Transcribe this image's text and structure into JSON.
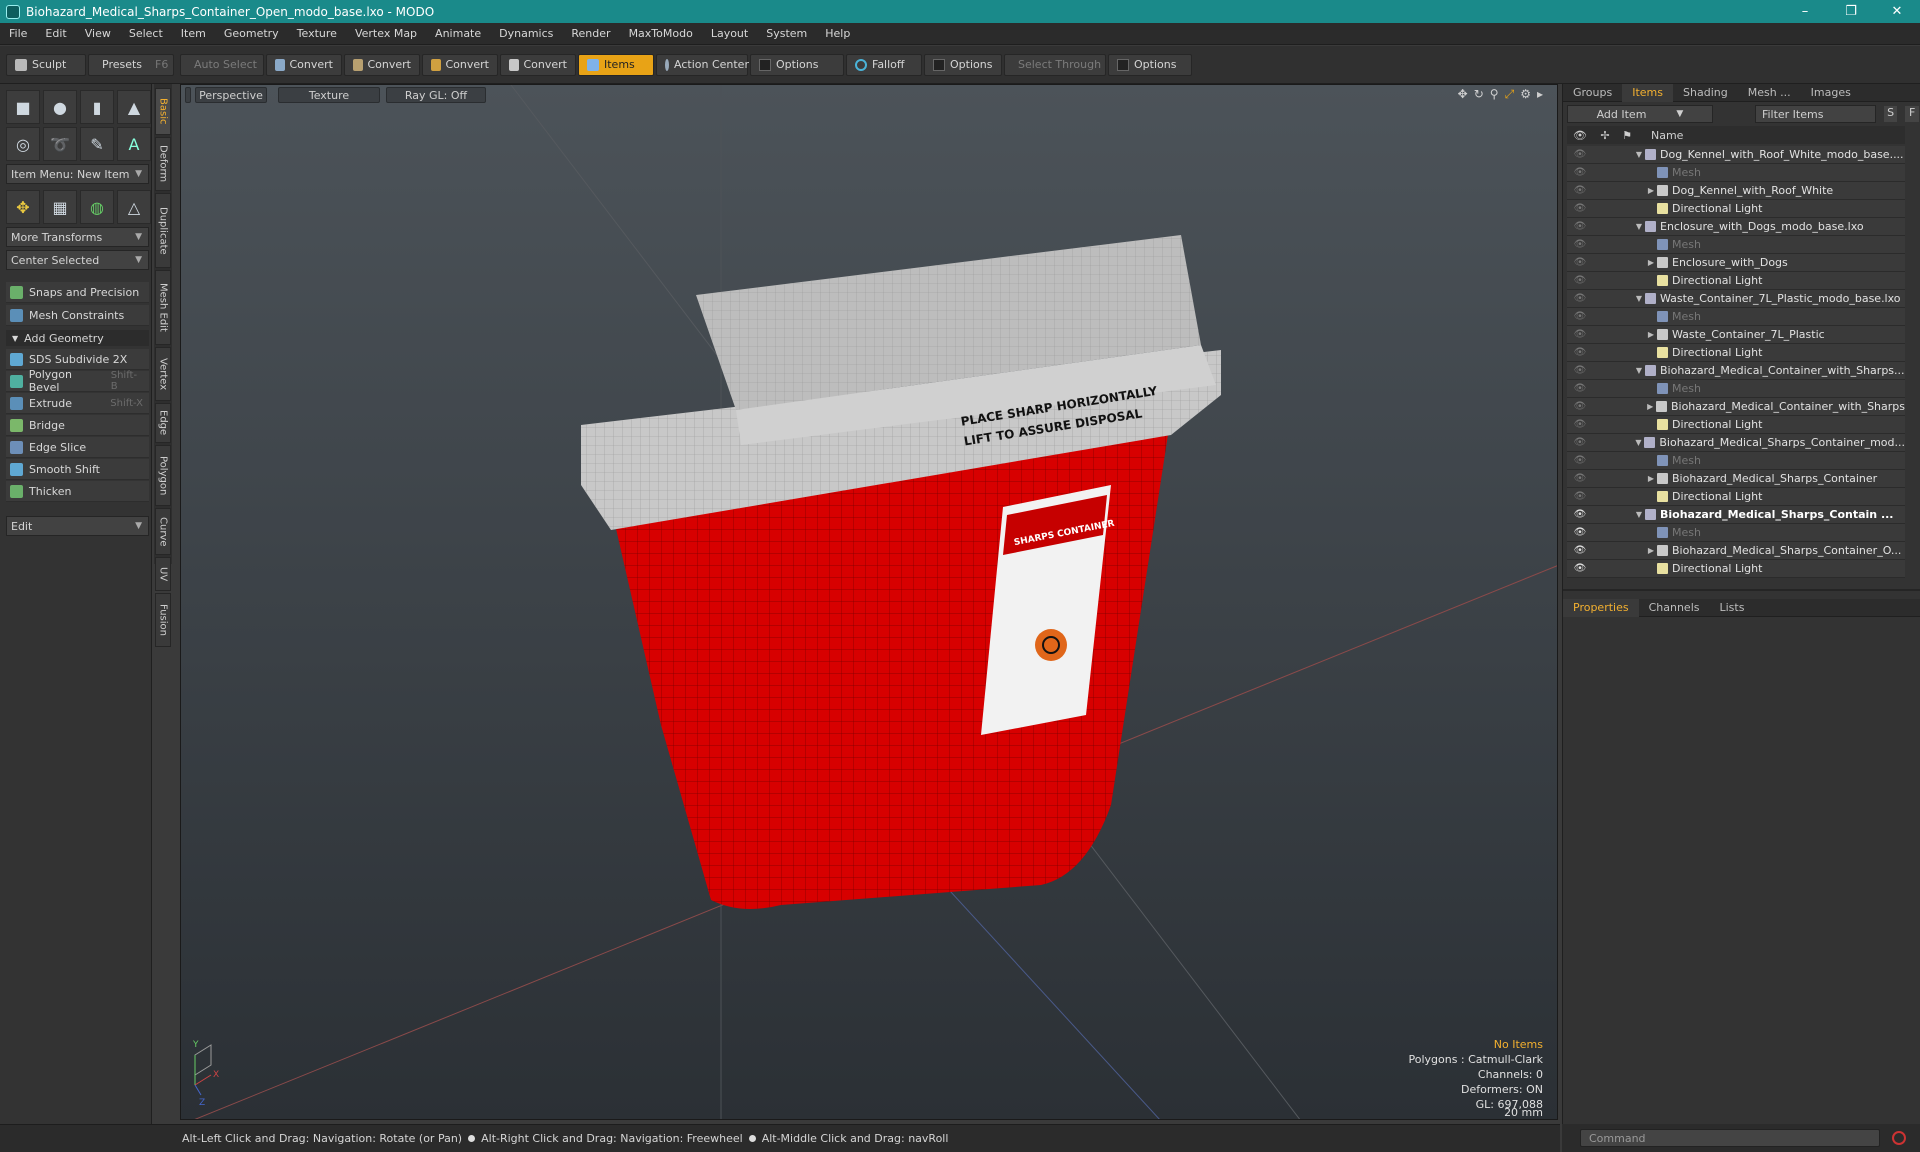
{
  "window": {
    "title": "Biohazard_Medical_Sharps_Container_Open_modo_base.lxo - MODO",
    "min": "–",
    "max": "❐",
    "close": "✕"
  },
  "menu": [
    "File",
    "Edit",
    "View",
    "Select",
    "Item",
    "Geometry",
    "Texture",
    "Vertex Map",
    "Animate",
    "Dynamics",
    "Render",
    "MaxToModo",
    "Layout",
    "System",
    "Help"
  ],
  "toolbar": {
    "sculpt": "Sculpt",
    "presets": "Presets",
    "presets_key": "F6",
    "auto_select": "Auto Select",
    "convert": "Convert",
    "items": "Items",
    "action_center": "Action Center",
    "options": "Options",
    "falloff": "Falloff",
    "select_through": "Select Through"
  },
  "left": {
    "item_menu": "Item Menu: New Item",
    "more_transforms": "More Transforms",
    "center_selected": "Center Selected",
    "snaps": "Snaps and Precision",
    "mesh_constraints": "Mesh Constraints",
    "add_geometry": "Add Geometry",
    "tools": [
      {
        "label": "SDS Subdivide 2X",
        "key": ""
      },
      {
        "label": "Polygon Bevel",
        "key": "Shift-B"
      },
      {
        "label": "Extrude",
        "key": "Shift-X"
      },
      {
        "label": "Bridge",
        "key": ""
      },
      {
        "label": "Edge Slice",
        "key": ""
      },
      {
        "label": "Smooth Shift",
        "key": ""
      },
      {
        "label": "Thicken",
        "key": ""
      }
    ],
    "edit": "Edit",
    "vtabs": [
      "Basic",
      "Deform",
      "Duplicate",
      "Mesh Edit",
      "Vertex",
      "Edge",
      "Polygon",
      "Curve",
      "UV",
      "Fusion"
    ]
  },
  "viewport": {
    "perspective": "Perspective",
    "texture": "Texture",
    "raygl": "Ray GL: Off",
    "info": {
      "no_items": "No Items",
      "polygons": "Polygons : Catmull-Clark",
      "channels": "Channels: 0",
      "deformers": "Deformers: ON",
      "gl": "GL: 697,088",
      "scale": "20 mm"
    },
    "label": {
      "line1": "PLACE SHARP HORIZONTALLY",
      "line2": "LIFT TO ASSURE DISPOSAL",
      "sticker": "SHARPS CONTAINER"
    },
    "gizmo": {
      "y": "Y",
      "x": "X",
      "z": "Z"
    }
  },
  "status": [
    "Alt-Left Click and Drag: Navigation: Rotate (or Pan)",
    "Alt-Right Click and Drag: Navigation: Freewheel",
    "Alt-Middle Click and Drag: navRoll"
  ],
  "right": {
    "tabs": [
      "Groups",
      "Items",
      "Shading",
      "Mesh ...",
      "Images"
    ],
    "add_item": "Add Item",
    "filter": "Filter Items",
    "s": "S",
    "f": "F",
    "name_col": "Name",
    "rows": [
      {
        "n": "Dog_Kennel_with_Roof_White_modo_base....",
        "lvl": 0,
        "tri": "▼",
        "type": "scene"
      },
      {
        "n": "Mesh",
        "lvl": 1,
        "tri": "",
        "type": "mesh",
        "dim": true
      },
      {
        "n": "Dog_Kennel_with_Roof_White",
        "lvl": 1,
        "tri": "▶",
        "type": "loc"
      },
      {
        "n": "Directional Light",
        "lvl": 1,
        "tri": "",
        "type": "light"
      },
      {
        "n": "Enclosure_with_Dogs_modo_base.lxo",
        "lvl": 0,
        "tri": "▼",
        "type": "scene"
      },
      {
        "n": "Mesh",
        "lvl": 1,
        "tri": "",
        "type": "mesh",
        "dim": true
      },
      {
        "n": "Enclosure_with_Dogs",
        "lvl": 1,
        "tri": "▶",
        "type": "loc"
      },
      {
        "n": "Directional Light",
        "lvl": 1,
        "tri": "",
        "type": "light"
      },
      {
        "n": "Waste_Container_7L_Plastic_modo_base.lxo",
        "lvl": 0,
        "tri": "▼",
        "type": "scene"
      },
      {
        "n": "Mesh",
        "lvl": 1,
        "tri": "",
        "type": "mesh",
        "dim": true
      },
      {
        "n": "Waste_Container_7L_Plastic",
        "lvl": 1,
        "tri": "▶",
        "type": "loc"
      },
      {
        "n": "Directional Light",
        "lvl": 1,
        "tri": "",
        "type": "light"
      },
      {
        "n": "Biohazard_Medical_Container_with_Sharps...",
        "lvl": 0,
        "tri": "▼",
        "type": "scene"
      },
      {
        "n": "Mesh",
        "lvl": 1,
        "tri": "",
        "type": "mesh",
        "dim": true
      },
      {
        "n": "Biohazard_Medical_Container_with_Sharps",
        "lvl": 1,
        "tri": "▶",
        "type": "loc"
      },
      {
        "n": "Directional Light",
        "lvl": 1,
        "tri": "",
        "type": "light"
      },
      {
        "n": "Biohazard_Medical_Sharps_Container_mod...",
        "lvl": 0,
        "tri": "▼",
        "type": "scene"
      },
      {
        "n": "Mesh",
        "lvl": 1,
        "tri": "",
        "type": "mesh",
        "dim": true
      },
      {
        "n": "Biohazard_Medical_Sharps_Container",
        "lvl": 1,
        "tri": "▶",
        "type": "loc"
      },
      {
        "n": "Directional Light",
        "lvl": 1,
        "tri": "",
        "type": "light"
      },
      {
        "n": "Biohazard_Medical_Sharps_Contain ...",
        "lvl": 0,
        "tri": "▼",
        "type": "scene",
        "bold": true
      },
      {
        "n": "Mesh",
        "lvl": 1,
        "tri": "",
        "type": "mesh",
        "dim": true,
        "on": true
      },
      {
        "n": "Biohazard_Medical_Sharps_Container_O...",
        "lvl": 1,
        "tri": "▶",
        "type": "loc",
        "on": true
      },
      {
        "n": "Directional Light",
        "lvl": 1,
        "tri": "",
        "type": "light",
        "on": true
      }
    ],
    "prop_tabs": [
      "Properties",
      "Channels",
      "Lists"
    ],
    "command": "Command"
  }
}
